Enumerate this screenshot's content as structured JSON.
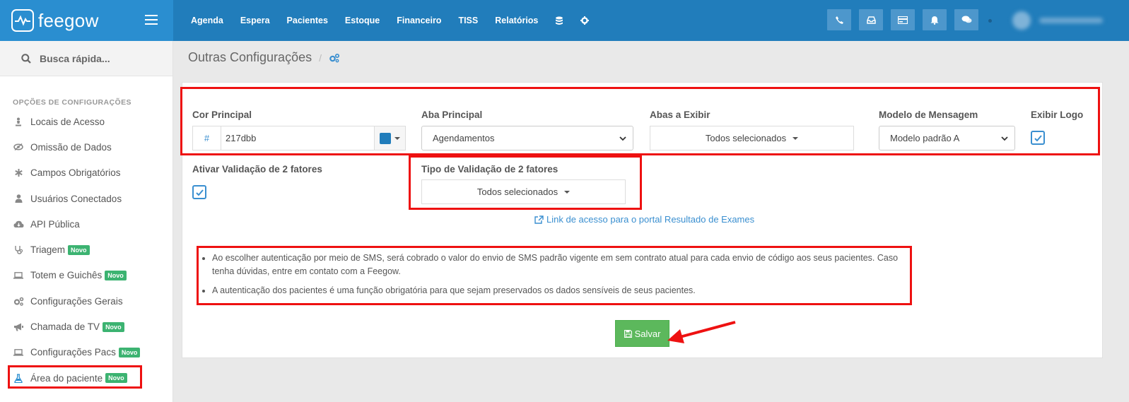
{
  "app": {
    "name": "feegow"
  },
  "nav": {
    "items": [
      "Agenda",
      "Espera",
      "Pacientes",
      "Estoque",
      "Financeiro",
      "TISS",
      "Relatórios"
    ],
    "icons": [
      "database-icon",
      "gear-icon"
    ]
  },
  "top_buttons": [
    "phone-icon",
    "inbox-icon",
    "card-icon",
    "bell-icon",
    "chat-icon"
  ],
  "sidebar": {
    "search_placeholder": "Busca rápida...",
    "section_title": "OPÇÕES DE CONFIGURAÇÕES",
    "items": [
      {
        "label": "Locais de Acesso",
        "icon": "person-icon",
        "badge": ""
      },
      {
        "label": "Omissão de Dados",
        "icon": "eye-slash-icon",
        "badge": ""
      },
      {
        "label": "Campos Obrigatórios",
        "icon": "asterisk-icon",
        "badge": ""
      },
      {
        "label": "Usuários Conectados",
        "icon": "user-icon",
        "badge": ""
      },
      {
        "label": "API Pública",
        "icon": "cloud-icon",
        "badge": ""
      },
      {
        "label": "Triagem",
        "icon": "stethoscope-icon",
        "badge": "Novo"
      },
      {
        "label": "Totem e Guichês",
        "icon": "laptop-icon",
        "badge": "Novo"
      },
      {
        "label": "Configurações Gerais",
        "icon": "gears-icon",
        "badge": ""
      },
      {
        "label": "Chamada de TV",
        "icon": "bullhorn-icon",
        "badge": "Novo"
      },
      {
        "label": "Configurações Pacs",
        "icon": "laptop-icon",
        "badge": "Novo"
      },
      {
        "label": "Área do paciente",
        "icon": "flask-icon",
        "badge": "Novo"
      }
    ]
  },
  "page": {
    "title": "Outras Configurações"
  },
  "form": {
    "cor_principal": {
      "label": "Cor Principal",
      "prefix": "#",
      "value": "217dbb",
      "swatch": "#217dbb"
    },
    "aba_principal": {
      "label": "Aba Principal",
      "value": "Agendamentos"
    },
    "abas_exibir": {
      "label": "Abas a Exibir",
      "value": "Todos selecionados"
    },
    "modelo_mensagem": {
      "label": "Modelo de Mensagem",
      "value": "Modelo padrão A"
    },
    "exibir_logo": {
      "label": "Exibir Logo",
      "checked": true
    },
    "validacao_2f": {
      "label": "Ativar Validação de 2 fatores",
      "checked": true
    },
    "tipo_validacao": {
      "label": "Tipo de Validação de 2 fatores",
      "value": "Todos selecionados"
    },
    "portal_link": "Link de acesso para o portal Resultado de Exames"
  },
  "notes": [
    "Ao escolher autenticação por meio de SMS, será cobrado o valor do envio de SMS padrão vigente em sem contrato atual para cada envio de código aos seus pacientes. Caso tenha dúvidas, entre em contato com a Feegow.",
    "A autenticação dos pacientes é uma função obrigatória para que sejam preservados os dados sensíveis de seus pacientes."
  ],
  "save_label": "Salvar",
  "colors": {
    "topbar": "#217dbb",
    "brand": "#2a8ed0",
    "save": "#5cb85c",
    "highlight": "#ee1111"
  }
}
